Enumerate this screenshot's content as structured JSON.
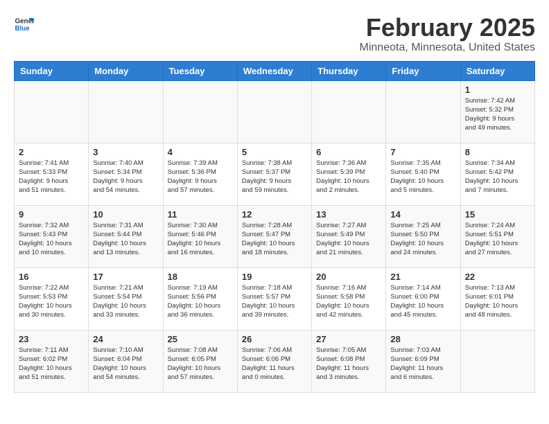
{
  "header": {
    "logo_general": "General",
    "logo_blue": "Blue",
    "title": "February 2025",
    "subtitle": "Minneota, Minnesota, United States"
  },
  "weekdays": [
    "Sunday",
    "Monday",
    "Tuesday",
    "Wednesday",
    "Thursday",
    "Friday",
    "Saturday"
  ],
  "weeks": [
    [
      {
        "day": "",
        "detail": ""
      },
      {
        "day": "",
        "detail": ""
      },
      {
        "day": "",
        "detail": ""
      },
      {
        "day": "",
        "detail": ""
      },
      {
        "day": "",
        "detail": ""
      },
      {
        "day": "",
        "detail": ""
      },
      {
        "day": "1",
        "detail": "Sunrise: 7:42 AM\nSunset: 5:32 PM\nDaylight: 9 hours\nand 49 minutes."
      }
    ],
    [
      {
        "day": "2",
        "detail": "Sunrise: 7:41 AM\nSunset: 5:33 PM\nDaylight: 9 hours\nand 51 minutes."
      },
      {
        "day": "3",
        "detail": "Sunrise: 7:40 AM\nSunset: 5:34 PM\nDaylight: 9 hours\nand 54 minutes."
      },
      {
        "day": "4",
        "detail": "Sunrise: 7:39 AM\nSunset: 5:36 PM\nDaylight: 9 hours\nand 57 minutes."
      },
      {
        "day": "5",
        "detail": "Sunrise: 7:38 AM\nSunset: 5:37 PM\nDaylight: 9 hours\nand 59 minutes."
      },
      {
        "day": "6",
        "detail": "Sunrise: 7:36 AM\nSunset: 5:39 PM\nDaylight: 10 hours\nand 2 minutes."
      },
      {
        "day": "7",
        "detail": "Sunrise: 7:35 AM\nSunset: 5:40 PM\nDaylight: 10 hours\nand 5 minutes."
      },
      {
        "day": "8",
        "detail": "Sunrise: 7:34 AM\nSunset: 5:42 PM\nDaylight: 10 hours\nand 7 minutes."
      }
    ],
    [
      {
        "day": "9",
        "detail": "Sunrise: 7:32 AM\nSunset: 5:43 PM\nDaylight: 10 hours\nand 10 minutes."
      },
      {
        "day": "10",
        "detail": "Sunrise: 7:31 AM\nSunset: 5:44 PM\nDaylight: 10 hours\nand 13 minutes."
      },
      {
        "day": "11",
        "detail": "Sunrise: 7:30 AM\nSunset: 5:46 PM\nDaylight: 10 hours\nand 16 minutes."
      },
      {
        "day": "12",
        "detail": "Sunrise: 7:28 AM\nSunset: 5:47 PM\nDaylight: 10 hours\nand 18 minutes."
      },
      {
        "day": "13",
        "detail": "Sunrise: 7:27 AM\nSunset: 5:49 PM\nDaylight: 10 hours\nand 21 minutes."
      },
      {
        "day": "14",
        "detail": "Sunrise: 7:25 AM\nSunset: 5:50 PM\nDaylight: 10 hours\nand 24 minutes."
      },
      {
        "day": "15",
        "detail": "Sunrise: 7:24 AM\nSunset: 5:51 PM\nDaylight: 10 hours\nand 27 minutes."
      }
    ],
    [
      {
        "day": "16",
        "detail": "Sunrise: 7:22 AM\nSunset: 5:53 PM\nDaylight: 10 hours\nand 30 minutes."
      },
      {
        "day": "17",
        "detail": "Sunrise: 7:21 AM\nSunset: 5:54 PM\nDaylight: 10 hours\nand 33 minutes."
      },
      {
        "day": "18",
        "detail": "Sunrise: 7:19 AM\nSunset: 5:56 PM\nDaylight: 10 hours\nand 36 minutes."
      },
      {
        "day": "19",
        "detail": "Sunrise: 7:18 AM\nSunset: 5:57 PM\nDaylight: 10 hours\nand 39 minutes."
      },
      {
        "day": "20",
        "detail": "Sunrise: 7:16 AM\nSunset: 5:58 PM\nDaylight: 10 hours\nand 42 minutes."
      },
      {
        "day": "21",
        "detail": "Sunrise: 7:14 AM\nSunset: 6:00 PM\nDaylight: 10 hours\nand 45 minutes."
      },
      {
        "day": "22",
        "detail": "Sunrise: 7:13 AM\nSunset: 6:01 PM\nDaylight: 10 hours\nand 48 minutes."
      }
    ],
    [
      {
        "day": "23",
        "detail": "Sunrise: 7:11 AM\nSunset: 6:02 PM\nDaylight: 10 hours\nand 51 minutes."
      },
      {
        "day": "24",
        "detail": "Sunrise: 7:10 AM\nSunset: 6:04 PM\nDaylight: 10 hours\nand 54 minutes."
      },
      {
        "day": "25",
        "detail": "Sunrise: 7:08 AM\nSunset: 6:05 PM\nDaylight: 10 hours\nand 57 minutes."
      },
      {
        "day": "26",
        "detail": "Sunrise: 7:06 AM\nSunset: 6:06 PM\nDaylight: 11 hours\nand 0 minutes."
      },
      {
        "day": "27",
        "detail": "Sunrise: 7:05 AM\nSunset: 6:08 PM\nDaylight: 11 hours\nand 3 minutes."
      },
      {
        "day": "28",
        "detail": "Sunrise: 7:03 AM\nSunset: 6:09 PM\nDaylight: 11 hours\nand 6 minutes."
      },
      {
        "day": "",
        "detail": ""
      }
    ]
  ]
}
